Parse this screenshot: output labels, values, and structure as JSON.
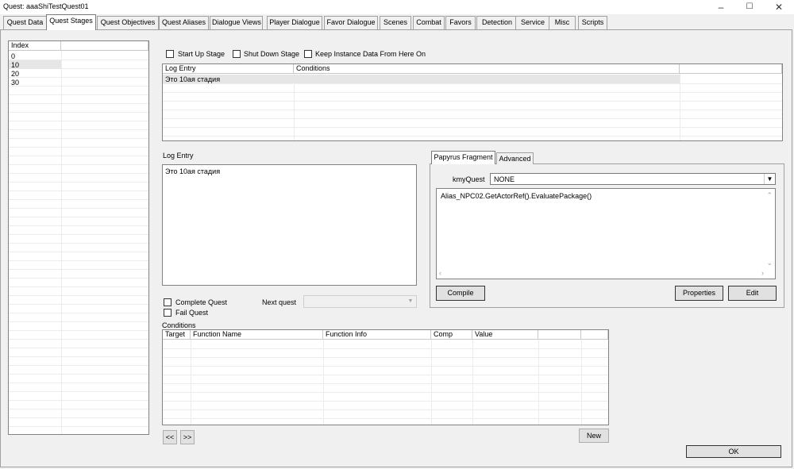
{
  "window": {
    "title": "Quest: aaaShiTestQuest01",
    "minimize": "–",
    "maximize": "☐",
    "close": "✕"
  },
  "tabs": [
    {
      "label": "Quest Data",
      "active": false
    },
    {
      "label": "Quest Stages",
      "active": true
    },
    {
      "label": "Quest Objectives",
      "active": false
    },
    {
      "label": "Quest Aliases",
      "active": false
    },
    {
      "label": "Dialogue Views",
      "active": false
    },
    {
      "label": "Player Dialogue",
      "active": false
    },
    {
      "label": "Favor Dialogue",
      "active": false
    },
    {
      "label": "Scenes",
      "active": false
    },
    {
      "label": "Combat",
      "active": false
    },
    {
      "label": "Favors",
      "active": false
    },
    {
      "label": "Detection",
      "active": false
    },
    {
      "label": "Service",
      "active": false
    },
    {
      "label": "Misc",
      "active": false
    },
    {
      "label": "Scripts",
      "active": false
    }
  ],
  "index_list": {
    "header": "Index",
    "items": [
      "0",
      "10",
      "20",
      "30"
    ],
    "selected": "10"
  },
  "stage_flags": {
    "start_up": "Start Up Stage",
    "shut_down": "Shut Down Stage",
    "keep_instance": "Keep Instance Data From Here On"
  },
  "log_table": {
    "headers": [
      "Log Entry",
      "Conditions"
    ],
    "rows": [
      [
        "Это 10ая стадия",
        ""
      ]
    ]
  },
  "log_entry": {
    "label": "Log Entry",
    "text": "Это 10ая стадия"
  },
  "complete_quest": "Complete Quest",
  "fail_quest": "Fail Quest",
  "next_quest": {
    "label": "Next quest",
    "value": ""
  },
  "conditions": {
    "label": "Conditions",
    "headers": [
      "Target",
      "Function Name",
      "Function Info",
      "Comp",
      "Value",
      "",
      ""
    ]
  },
  "nav": {
    "prev": "<<",
    "next": ">>"
  },
  "new_button": "New",
  "fragment_tabs": [
    {
      "label": "Papyrus Fragment",
      "active": true
    },
    {
      "label": "Advanced",
      "active": false
    }
  ],
  "fragment": {
    "kmy_label": "kmyQuest",
    "kmy_value": "NONE",
    "code": "Alias_NPC02.GetActorRef().EvaluatePackage()"
  },
  "compile_button": "Compile",
  "properties_button": "Properties",
  "edit_button": "Edit",
  "ok_button": "OK"
}
